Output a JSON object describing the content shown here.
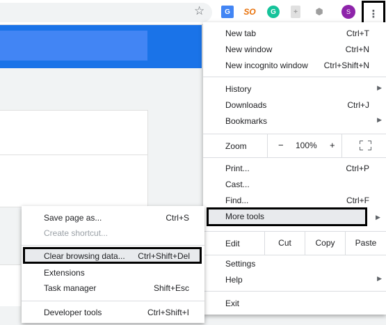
{
  "toolbar": {
    "extensions": [
      "translate-icon",
      "so-icon",
      "grammarly-icon",
      "extension-icon",
      "cube-icon"
    ],
    "so_label": "SO",
    "grammarly_label": "G",
    "avatar_initial": "S",
    "kebab_glyph": "⋮",
    "star_glyph": "☆"
  },
  "menu": {
    "new_tab": {
      "label": "New tab",
      "shortcut": "Ctrl+T"
    },
    "new_window": {
      "label": "New window",
      "shortcut": "Ctrl+N"
    },
    "new_incognito": {
      "label": "New incognito window",
      "shortcut": "Ctrl+Shift+N"
    },
    "history": {
      "label": "History"
    },
    "downloads": {
      "label": "Downloads",
      "shortcut": "Ctrl+J"
    },
    "bookmarks": {
      "label": "Bookmarks"
    },
    "zoom": {
      "label": "Zoom",
      "minus": "−",
      "level": "100%",
      "plus": "+"
    },
    "print": {
      "label": "Print...",
      "shortcut": "Ctrl+P"
    },
    "cast": {
      "label": "Cast..."
    },
    "find": {
      "label": "Find...",
      "shortcut": "Ctrl+F"
    },
    "more_tools": {
      "label": "More tools"
    },
    "edit": {
      "label": "Edit",
      "cut": "Cut",
      "copy": "Copy",
      "paste": "Paste"
    },
    "settings": {
      "label": "Settings"
    },
    "help": {
      "label": "Help"
    },
    "exit": {
      "label": "Exit"
    }
  },
  "submenu": {
    "save_page": {
      "label": "Save page as...",
      "shortcut": "Ctrl+S"
    },
    "create_shortcut": {
      "label": "Create shortcut..."
    },
    "clear_data": {
      "label": "Clear browsing data...",
      "shortcut": "Ctrl+Shift+Del"
    },
    "extensions": {
      "label": "Extensions"
    },
    "task_manager": {
      "label": "Task manager",
      "shortcut": "Shift+Esc"
    },
    "developer_tools": {
      "label": "Developer tools",
      "shortcut": "Ctrl+Shift+I"
    }
  },
  "colors": {
    "accent": "#1a73e8",
    "highlight": "#e8eaed",
    "annotation_border": "#000000",
    "avatar": "#8e24aa"
  }
}
